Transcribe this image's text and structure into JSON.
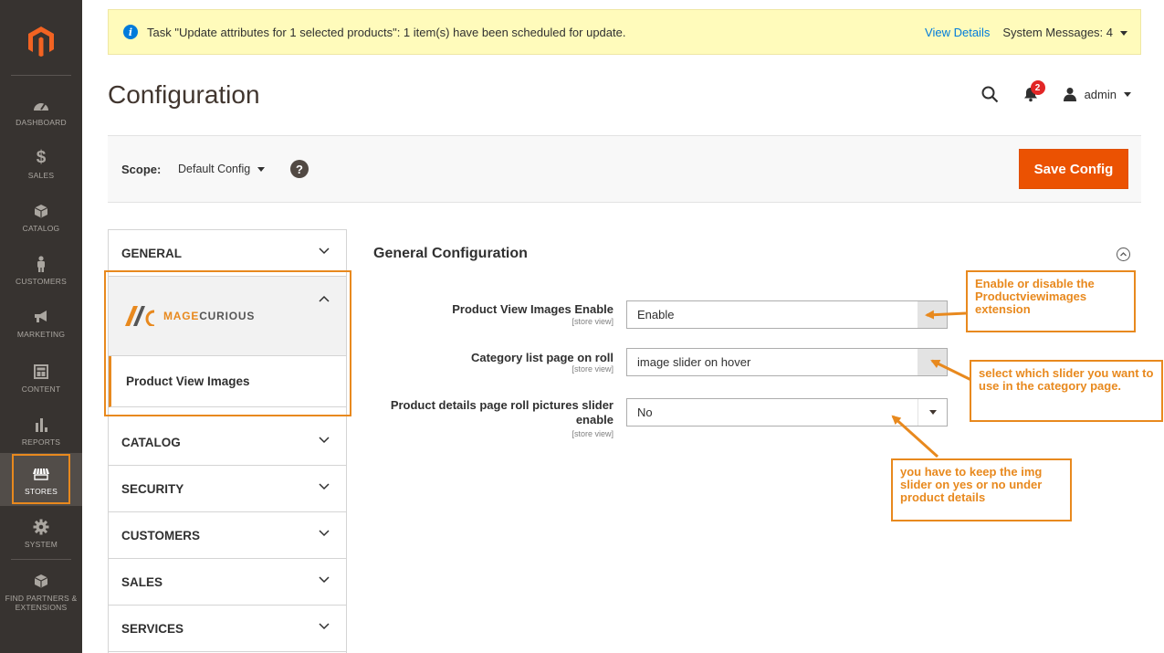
{
  "sidebar": {
    "logo_icon": "magento-logo-icon",
    "items": [
      {
        "label": "DASHBOARD",
        "icon": "dashboard-icon"
      },
      {
        "label": "SALES",
        "icon": "dollar-icon"
      },
      {
        "label": "CATALOG",
        "icon": "box-icon"
      },
      {
        "label": "CUSTOMERS",
        "icon": "person-icon"
      },
      {
        "label": "MARKETING",
        "icon": "megaphone-icon"
      },
      {
        "label": "CONTENT",
        "icon": "layout-icon"
      },
      {
        "label": "REPORTS",
        "icon": "bar-chart-icon"
      },
      {
        "label": "STORES",
        "icon": "storefront-icon"
      },
      {
        "label": "SYSTEM",
        "icon": "gear-icon"
      },
      {
        "label": "FIND PARTNERS & EXTENSIONS",
        "icon": "cube-icon"
      }
    ],
    "active": "STORES"
  },
  "system_message": {
    "text": "Task \"Update attributes for 1 selected products\": 1 item(s) have been scheduled for update.",
    "view_details": "View Details",
    "system_messages": "System Messages: 4"
  },
  "header": {
    "title": "Configuration",
    "notification_count": "2",
    "user": "admin"
  },
  "scope": {
    "label": "Scope:",
    "value": "Default Config",
    "help": "?",
    "save_label": "Save Config"
  },
  "tabs": {
    "general": "GENERAL",
    "magecurious_brand": "MAGECURIOUS",
    "product_view_images": "Product View Images",
    "catalog": "CATALOG",
    "security": "SECURITY",
    "customers": "CUSTOMERS",
    "sales": "SALES",
    "services": "SERVICES"
  },
  "section": {
    "title": "General Configuration",
    "fields": [
      {
        "label": "Product View Images Enable",
        "scope": "[store view]",
        "value": "Enable"
      },
      {
        "label": "Category list page on roll",
        "scope": "[store view]",
        "value": "image slider on hover"
      },
      {
        "label": "Product details page roll pictures slider enable",
        "scope": "[store view]",
        "value": "No"
      }
    ]
  },
  "annotations": {
    "enable": "Enable or disable the Productviewimages extension",
    "slider": "select which slider you want to use in the category page.",
    "details": "you have to keep the img slider on yes or no under product details"
  },
  "colors": {
    "sidebar_bg": "#373330",
    "accent": "#eb5202",
    "annotation": "#e8891e",
    "message_bg": "#fffbbb",
    "link": "#007bdb"
  }
}
